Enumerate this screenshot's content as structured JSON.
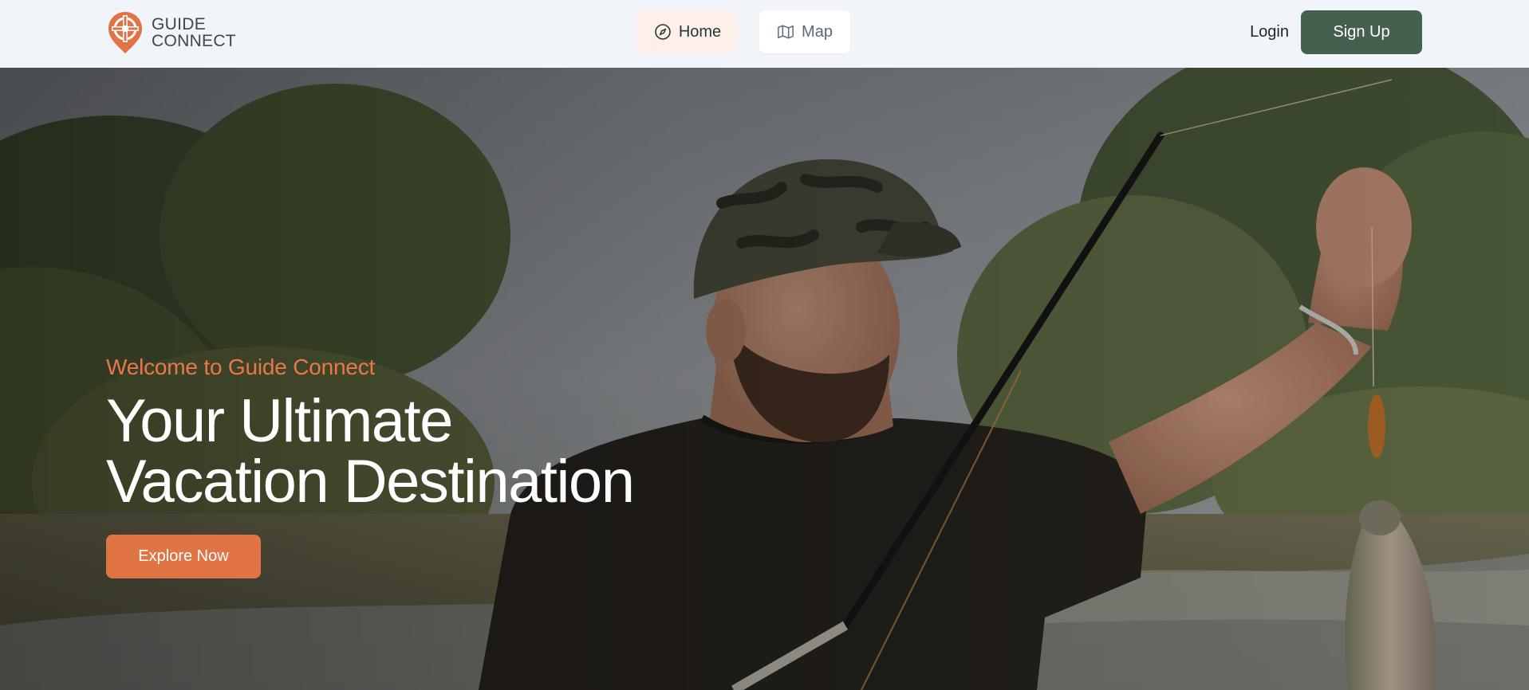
{
  "brand": {
    "name_line1": "GUIDE",
    "name_line2": "CONNECT",
    "logo_icon": "map-pin-crosshair-icon",
    "color": "#e07444"
  },
  "nav": {
    "tabs": [
      {
        "label": "Home",
        "icon": "compass-icon",
        "active": true
      },
      {
        "label": "Map",
        "icon": "map-icon",
        "active": false
      }
    ]
  },
  "auth": {
    "login_label": "Login",
    "signup_label": "Sign Up"
  },
  "hero": {
    "eyebrow": "Welcome to Guide Connect",
    "title": "Your Ultimate Vacation Destination",
    "cta_label": "Explore Now",
    "image_subject": "Man in camo cap holding fishing rod and a caught trout by a river"
  },
  "colors": {
    "accent": "#e07444",
    "primary": "#44604f",
    "header_bg": "#f1f4f9",
    "active_tab_bg": "#fdf0eb"
  }
}
